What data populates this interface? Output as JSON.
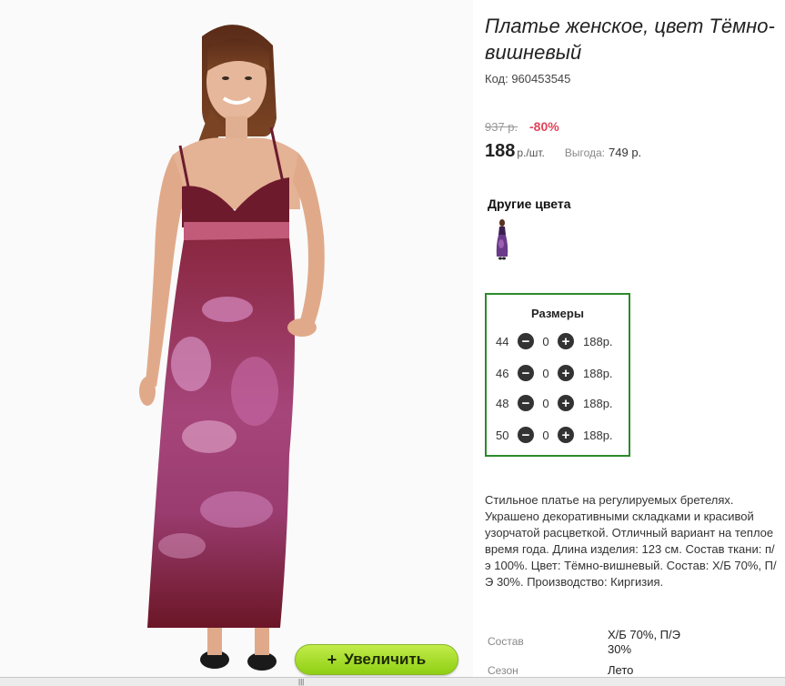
{
  "product": {
    "title": "Платье женское, цвет Тёмно-вишневый",
    "code": "Код: 960453545",
    "old_price": "937 р.",
    "discount": "-80%",
    "price": "188",
    "unit": "р./шт.",
    "benefit_label": "Выгода:",
    "benefit_value": "749 р."
  },
  "gallery": {
    "zoom_label": "Увеличить",
    "zoom_icon": "plus-icon"
  },
  "other_colors": {
    "title": "Другие цвета"
  },
  "sizes": {
    "title": "Размеры",
    "rows": [
      {
        "size": "44",
        "qty": "0",
        "price": "188р."
      },
      {
        "size": "46",
        "qty": "0",
        "price": "188р."
      },
      {
        "size": "48",
        "qty": "0",
        "price": "188р."
      },
      {
        "size": "50",
        "qty": "0",
        "price": "188р."
      }
    ]
  },
  "description": "Стильное платье на регулируемых бретелях. Украшено декоративными складками и красивой узорчатой расцветкой. Отличный вариант на теплое время года. Длина изделия: 123 см. Состав ткани: п/э 100%. Цвет: Тёмно-вишневый. Состав: Х/Б 70%, П/Э 30%. Производство: Киргизия.",
  "specs": [
    {
      "label": "Состав",
      "value": "Х/Б 70%, П/Э 30%"
    },
    {
      "label": "Сезон",
      "value": "Лето"
    }
  ],
  "colors": {
    "frame_green": "#2b8a2b",
    "discount_red": "#e0455a",
    "button_green": "#a8de2c"
  }
}
